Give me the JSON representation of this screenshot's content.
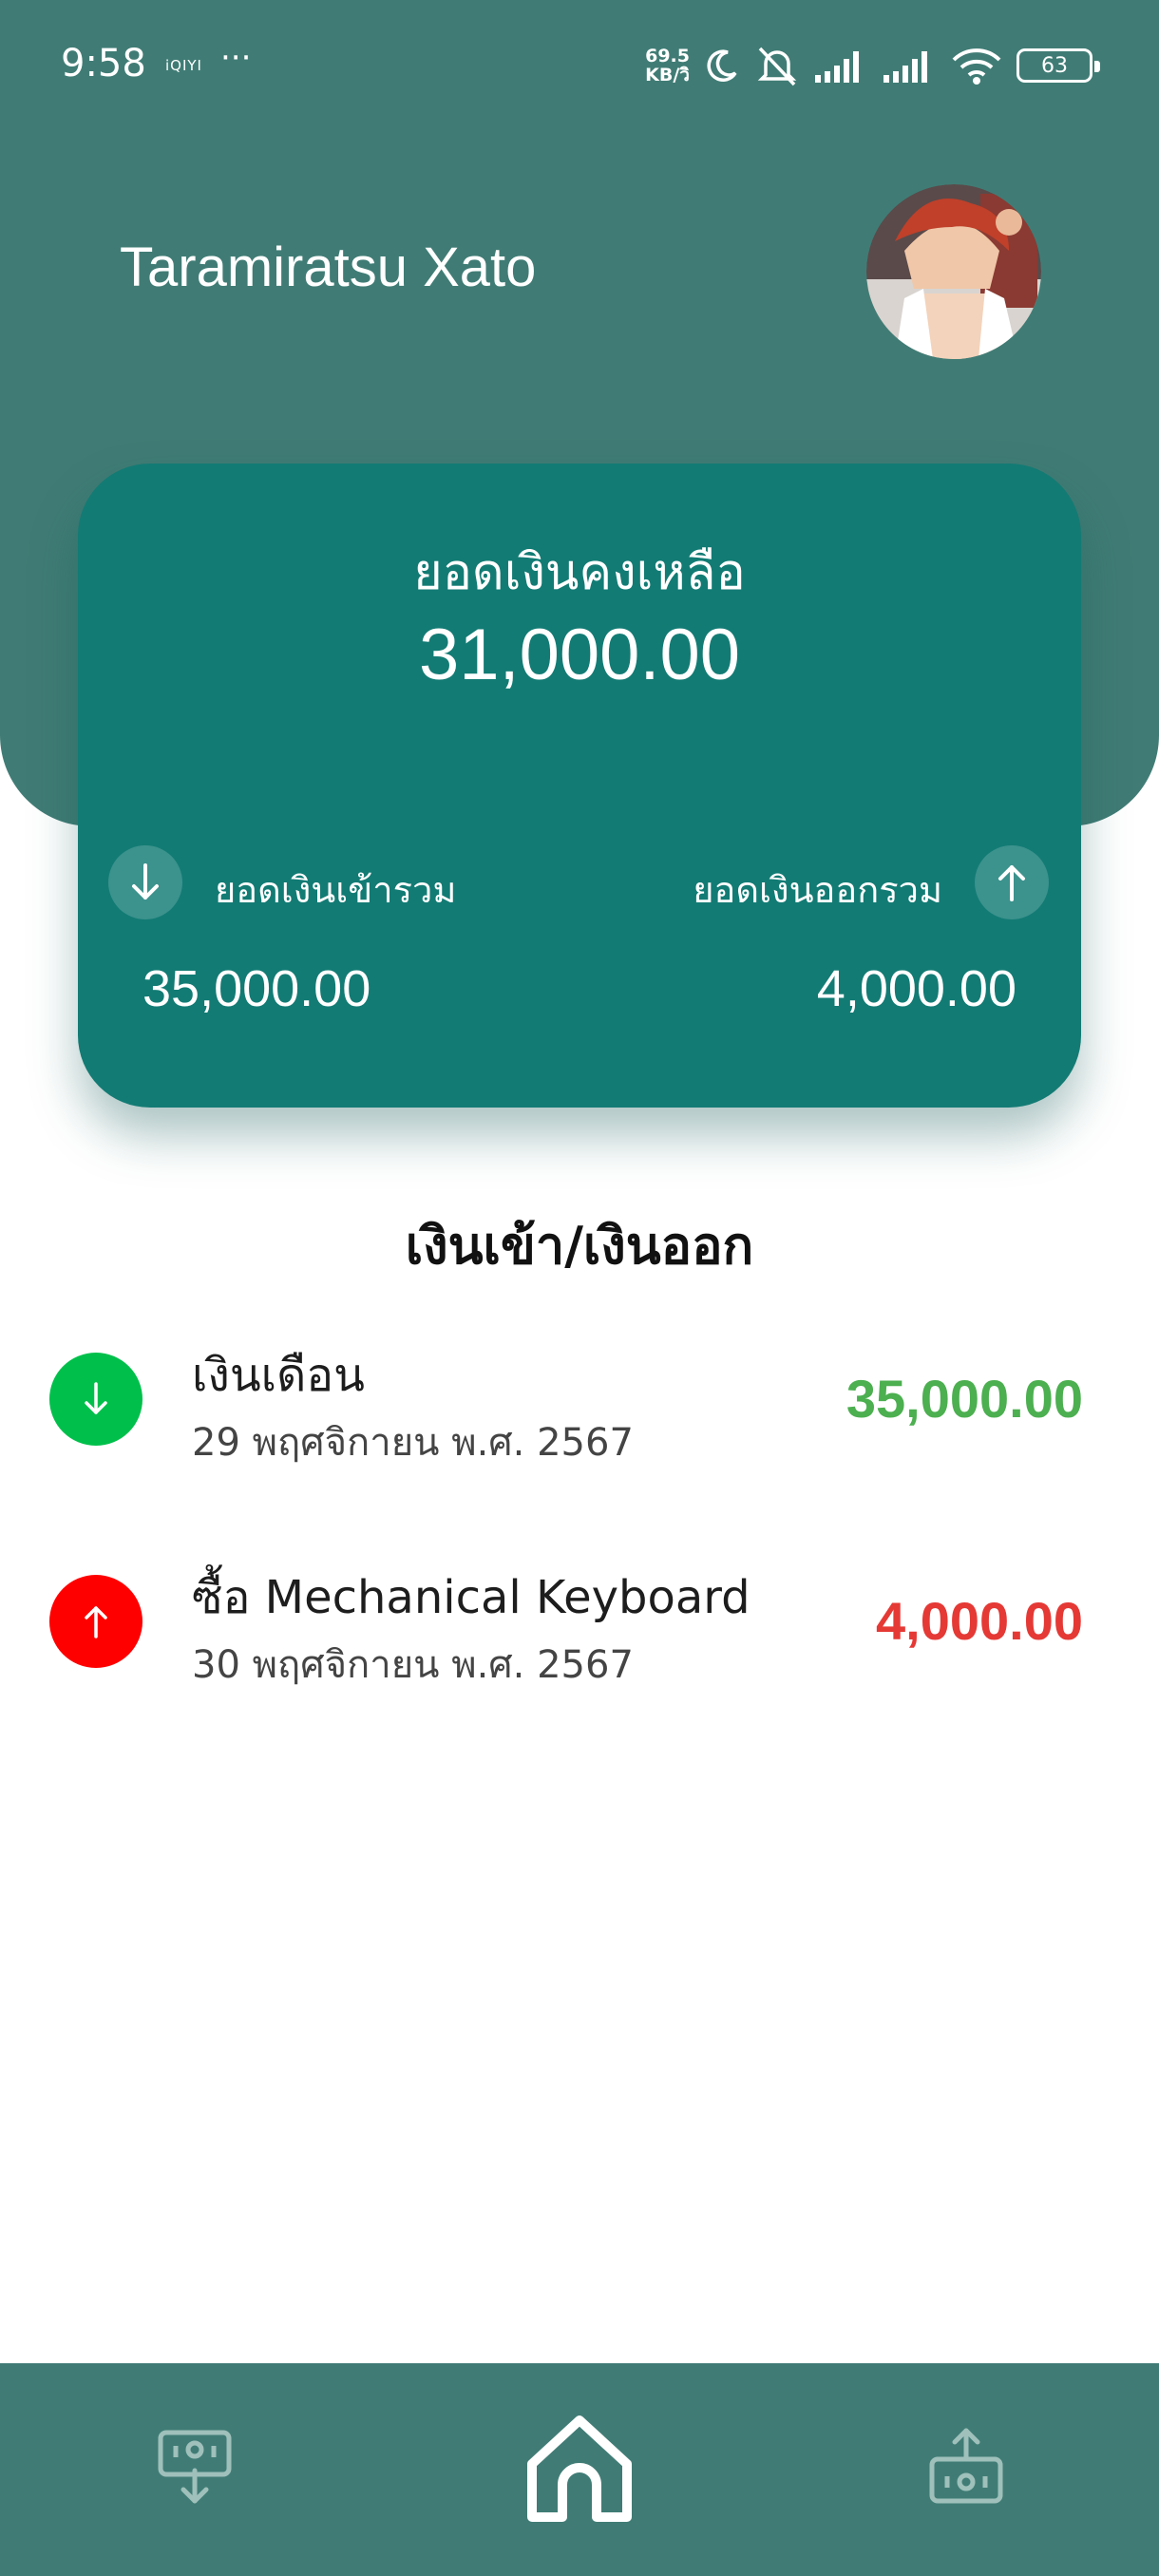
{
  "status_bar": {
    "time": "9:58",
    "brand": "iQIYI",
    "dots": "···",
    "net_speed_value": "69.5",
    "net_speed_unit": "KB/วิ",
    "battery": "63"
  },
  "header": {
    "user_name": "Taramiratsu Xato"
  },
  "balance_card": {
    "title": "ยอดเงินคงเหลือ",
    "balance": "31,000.00",
    "income_label": "ยอดเงินเข้ารวม",
    "income_total": "35,000.00",
    "expense_label": "ยอดเงินออกรวม",
    "expense_total": "4,000.00"
  },
  "transactions_section": {
    "title": "เงินเข้า/เงินออก",
    "items": [
      {
        "title": "เงินเดือน",
        "date": "29 พฤศจิกายน พ.ศ. 2567",
        "amount": "35,000.00",
        "type": "income",
        "color": "#4caf50",
        "icon_color": "#00c04b"
      },
      {
        "title": "ซื้อ Mechanical Keyboard",
        "date": "30 พฤศจิกายน พ.ศ. 2567",
        "amount": "4,000.00",
        "type": "expense",
        "color": "#e53935",
        "icon_color": "#ff0000"
      }
    ]
  },
  "bottom_nav": {
    "items": [
      "income-add-icon",
      "home-icon",
      "expense-add-icon"
    ],
    "active": "home-icon"
  },
  "colors": {
    "header": "#407c75",
    "card": "#127b74",
    "income": "#4caf50",
    "expense": "#e53935"
  }
}
